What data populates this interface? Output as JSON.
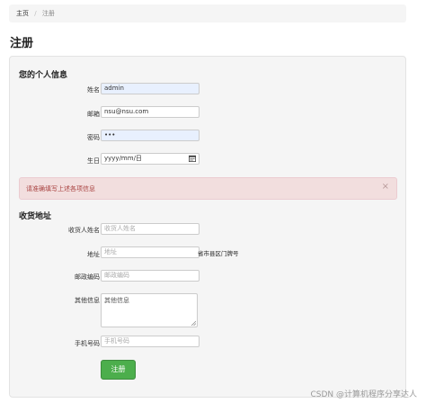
{
  "breadcrumb": {
    "home": "主页",
    "separator": "/",
    "current": "注册"
  },
  "page_title": "注册",
  "personal": {
    "legend": "您的个人信息",
    "required_mark": "*",
    "username": {
      "label": "姓名",
      "value": "admin"
    },
    "email": {
      "label": "邮箱",
      "value": "nsu@nsu.com"
    },
    "password": {
      "label": "密码",
      "value": "•••"
    },
    "birthday": {
      "label": "生日",
      "placeholder": "yyyy/mm/日",
      "icon": "calendar-icon"
    }
  },
  "alert": {
    "message": "请准确填写上述各项信息",
    "close": "×"
  },
  "shipping": {
    "legend": "收货地址",
    "recipient": {
      "label": "收货人姓名",
      "placeholder": "收货人姓名"
    },
    "address": {
      "label": "地址",
      "placeholder": "地址",
      "suffix": "省市县区门牌号"
    },
    "zip": {
      "label": "邮政编码",
      "placeholder": "邮政编码"
    },
    "other": {
      "label": "其他信息",
      "placeholder": "其他信息"
    },
    "phone": {
      "label": "手机号码",
      "placeholder": "手机号码"
    }
  },
  "submit_label": "注册",
  "watermark": "CSDN @计算机程序分享达人",
  "colors": {
    "alert_bg": "#f2dede",
    "alert_text": "#a94442",
    "button": "#4cae4c",
    "autofill": "#e8f0fe"
  }
}
